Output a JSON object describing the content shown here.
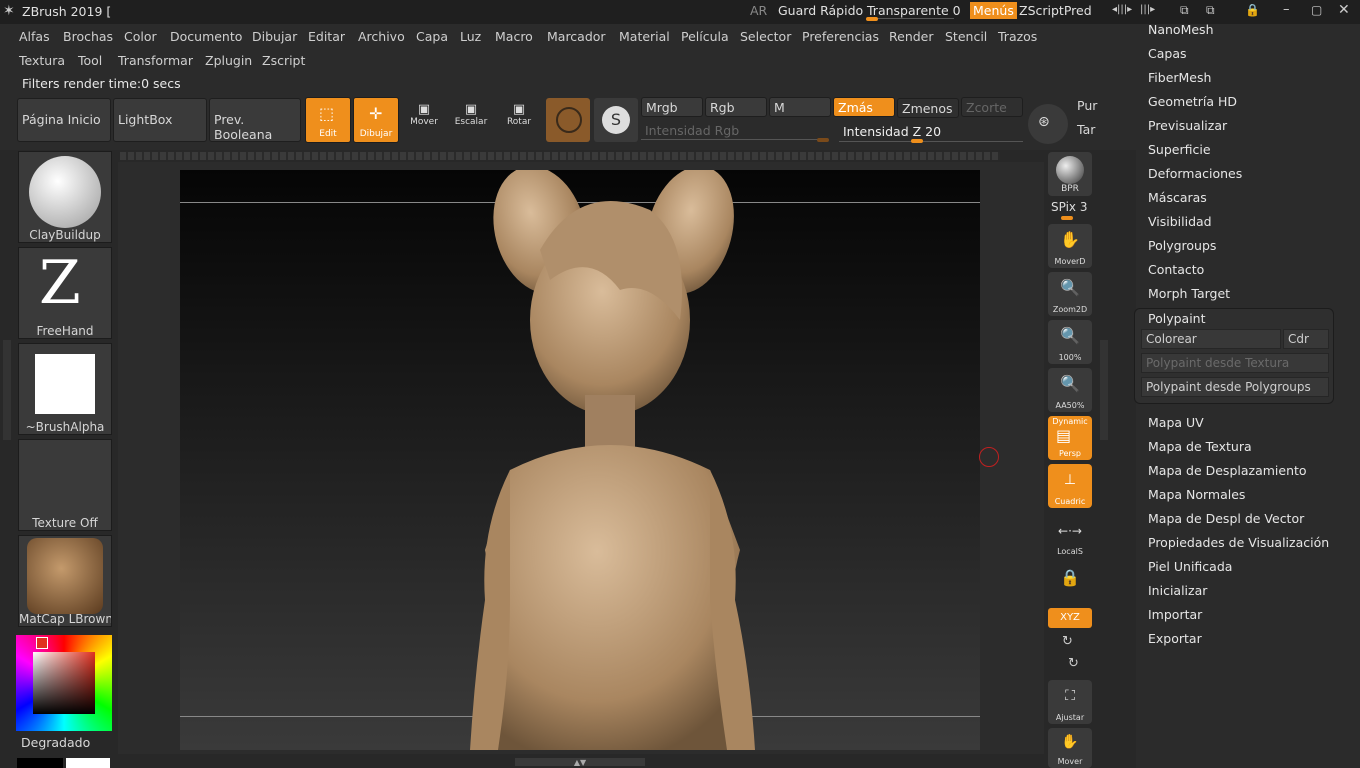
{
  "title_bar": {
    "app_title": "ZBrush 2019 [",
    "ar": "AR",
    "quick_save": "Guard Rápido",
    "transparent": "Transparente 0",
    "menus": "Menús",
    "zscript_pred": "ZScriptPred"
  },
  "menu_row1": [
    "Alfas",
    "Brochas",
    "Color",
    "Documento",
    "Dibujar",
    "Editar",
    "Archivo",
    "Capa",
    "Luz",
    "Macro",
    "Marcador",
    "Material",
    "Película",
    "Selector",
    "Preferencias",
    "Render",
    "Stencil",
    "Trazos"
  ],
  "menu_row2": [
    "Textura",
    "Tool",
    "Transformar",
    "Zplugin",
    "Zscript"
  ],
  "status_text": "Filters render time:0 secs",
  "toolbar": {
    "home_page": "Página Inicio",
    "lightbox": "LightBox",
    "prev_boolean": "Prev. Booleana",
    "edit": "Edit",
    "draw": "Dibujar",
    "move": "Mover",
    "scale": "Escalar",
    "rotate": "Rotar",
    "mrgb": "Mrgb",
    "rgb": "Rgb",
    "m": "M",
    "zadd": "Zmás",
    "zsub": "Zmenos",
    "zcut": "Zcorte",
    "rgb_intensity": "Intensidad Rgb",
    "z_intensity": "Intensidad Z 20",
    "pur": "Pur",
    "tar": "Tar"
  },
  "left_shelf": {
    "brush": "ClayBuildup",
    "stroke": "FreeHand",
    "alpha": "~BrushAlpha",
    "texture": "Texture Off",
    "material": "MatCap LBrownC",
    "gradient": "Degradado"
  },
  "right_shelf": {
    "bpr": "BPR",
    "spix": "SPix 3",
    "moverd": "MoverD",
    "zoom2d": "Zoom2D",
    "zoom100": "100%",
    "aa50": "AA50%",
    "dynamic": "Dynamic",
    "persp": "Persp",
    "cuadric": "Cuadric",
    "locals": "LocalS",
    "xyz": "XYZ",
    "ajustar": "Ajustar",
    "mover": "Mover"
  },
  "right_tray": {
    "items_top": [
      "NanoMesh",
      "Capas",
      "FiberMesh",
      "Geometría HD",
      "Previsualizar",
      "Superficie",
      "Deformaciones",
      "Máscaras",
      "Visibilidad",
      "Polygroups",
      "Contacto",
      "Morph Target"
    ],
    "polypaint": {
      "title": "Polypaint",
      "colorear": "Colorear",
      "cdr": "Cdr",
      "from_texture": "Polypaint desde Textura",
      "from_polygroups": "Polypaint desde Polygroups"
    },
    "items_bottom": [
      "Mapa UV",
      "Mapa de Textura",
      "Mapa de Desplazamiento",
      "Mapa Normales",
      "Mapa de Despl de Vector",
      "Propiedades de Visualización",
      "Piel Unificada",
      "Inicializar",
      "Importar",
      "Exportar"
    ]
  },
  "colors": {
    "accent": "#ef8f1c",
    "background": "#282828"
  }
}
